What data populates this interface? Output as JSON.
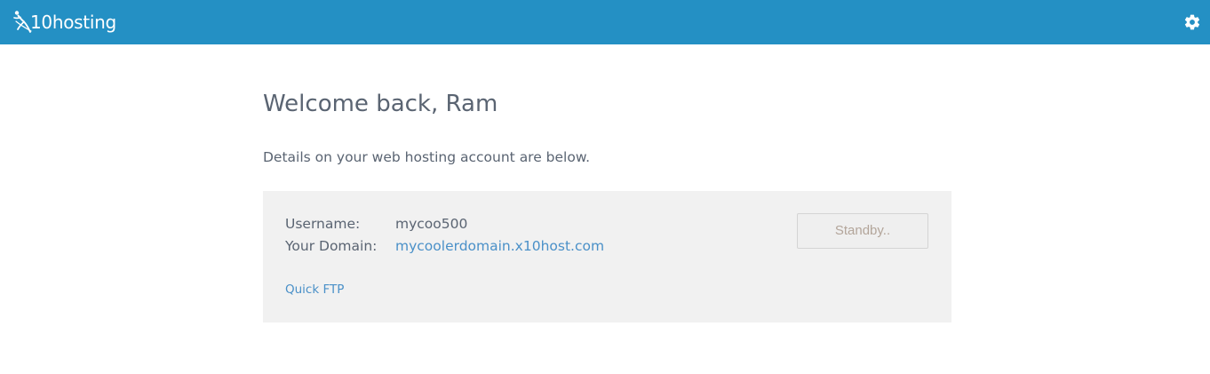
{
  "header": {
    "logo_text": "10hosting",
    "brand_color": "#2490c4",
    "logo_icon": "x10-figure-logo",
    "settings_icon": "gear-icon"
  },
  "main": {
    "welcome": "Welcome back, Ram",
    "details": "Details on your web hosting account are below."
  },
  "account": {
    "username_label": "Username:",
    "username_value": "mycoo500",
    "domain_label": "Your Domain:",
    "domain_value": "mycoolerdomain.x10host.com",
    "quick_ftp": "Quick FTP",
    "status_button": "Standby.."
  }
}
